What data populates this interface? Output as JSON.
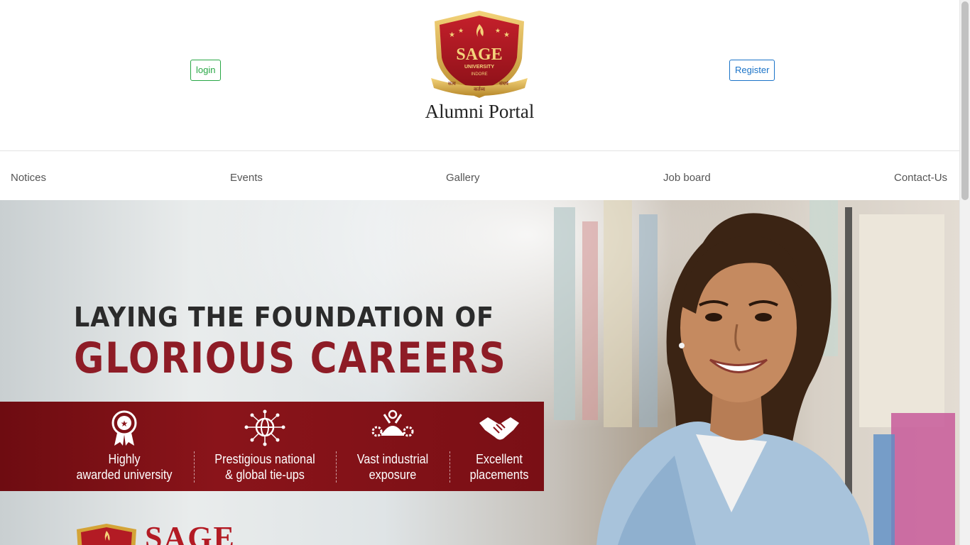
{
  "header": {
    "login_label": "login",
    "register_label": "Register",
    "title": "Alumni Portal",
    "logo": {
      "name": "SAGE",
      "sub1": "UNIVERSITY",
      "sub2": "INDORE",
      "motto_left": "सत्य",
      "motto_center": "कर्तव्य",
      "motto_right": "संघर्ष"
    }
  },
  "nav": {
    "items": [
      {
        "label": "Notices"
      },
      {
        "label": "Events"
      },
      {
        "label": "Gallery"
      },
      {
        "label": "Job board"
      },
      {
        "label": "Contact-Us"
      }
    ]
  },
  "hero": {
    "line1": "LAYING THE FOUNDATION OF",
    "line2": "GLORIOUS CAREERS",
    "features": [
      {
        "icon": "award-ribbon-icon",
        "line1": "Highly",
        "line2": "awarded university"
      },
      {
        "icon": "global-network-icon",
        "line1": "Prestigious national",
        "line2": "& global tie-ups"
      },
      {
        "icon": "industry-tools-icon",
        "line1": "Vast industrial",
        "line2": "exposure"
      },
      {
        "icon": "handshake-icon",
        "line1": "Excellent",
        "line2": "placements"
      }
    ],
    "bottom_brand": "SAGE"
  },
  "colors": {
    "brand_red": "#8e1c26",
    "login_green": "#28a745",
    "register_blue": "#1a73c8",
    "gold": "#d4a437"
  }
}
